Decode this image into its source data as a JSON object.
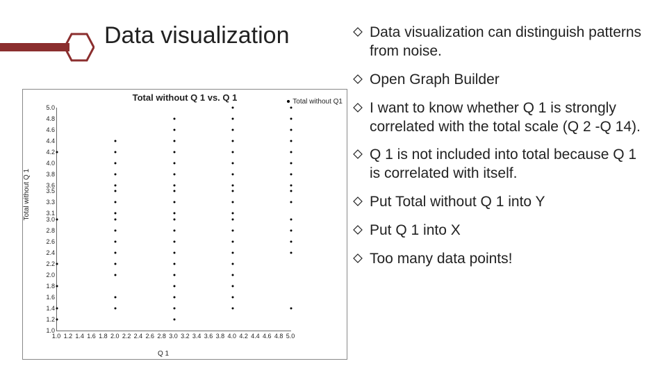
{
  "title": "Data visualization",
  "bullets": [
    "Data visualization can distinguish patterns from noise.",
    "Open Graph Builder",
    "I want to know whether Q 1 is strongly correlated with the total scale (Q 2 -Q 14).",
    "Q 1 is not included into total because Q 1 is correlated with itself.",
    "Put Total without Q 1 into Y",
    "Put Q 1 into X",
    "Too many data points!"
  ],
  "chart_data": {
    "type": "scatter",
    "title": "Total without Q 1 vs. Q 1",
    "xlabel": "Q 1",
    "ylabel": "Total without Q 1",
    "legend": [
      "Total without Q1"
    ],
    "xlim": [
      1.0,
      5.0
    ],
    "ylim": [
      1.0,
      5.0
    ],
    "xticks": [
      1.0,
      1.2,
      1.4,
      1.6,
      1.8,
      2.0,
      2.2,
      2.4,
      2.6,
      2.8,
      3.0,
      3.2,
      3.4,
      3.6,
      3.8,
      4.0,
      4.2,
      4.4,
      4.6,
      4.8,
      5.0
    ],
    "yticks": [
      1.0,
      1.2,
      1.4,
      1.6,
      1.8,
      2.0,
      2.2,
      2.4,
      2.6,
      2.8,
      3.0,
      3.1,
      3.3,
      3.5,
      3.6,
      3.8,
      4.0,
      4.2,
      4.4,
      4.6,
      4.8,
      5.0
    ],
    "series": [
      {
        "name": "Total without Q1",
        "x_values": [
          1,
          2,
          3,
          4,
          5
        ],
        "y_values_per_x": {
          "1": [
            1.2,
            1.4,
            1.8,
            2.2,
            3.0,
            4.2
          ],
          "2": [
            1.4,
            1.6,
            2.0,
            2.2,
            2.4,
            2.6,
            2.8,
            3.0,
            3.1,
            3.3,
            3.5,
            3.6,
            3.8,
            4.0,
            4.2,
            4.4
          ],
          "3": [
            1.2,
            1.4,
            1.6,
            1.8,
            2.0,
            2.2,
            2.4,
            2.6,
            2.8,
            3.0,
            3.1,
            3.3,
            3.5,
            3.6,
            3.8,
            4.0,
            4.2,
            4.4,
            4.6,
            4.8
          ],
          "4": [
            1.4,
            1.6,
            1.8,
            2.0,
            2.2,
            2.4,
            2.6,
            2.8,
            3.0,
            3.1,
            3.3,
            3.5,
            3.6,
            3.8,
            4.0,
            4.2,
            4.4,
            4.6,
            4.8,
            5.0
          ],
          "5": [
            1.4,
            2.4,
            2.6,
            2.8,
            3.0,
            3.3,
            3.5,
            3.6,
            3.8,
            4.0,
            4.2,
            4.4,
            4.6,
            4.8,
            5.0
          ]
        }
      }
    ]
  },
  "colors": {
    "accent": "#8b2e2e"
  }
}
